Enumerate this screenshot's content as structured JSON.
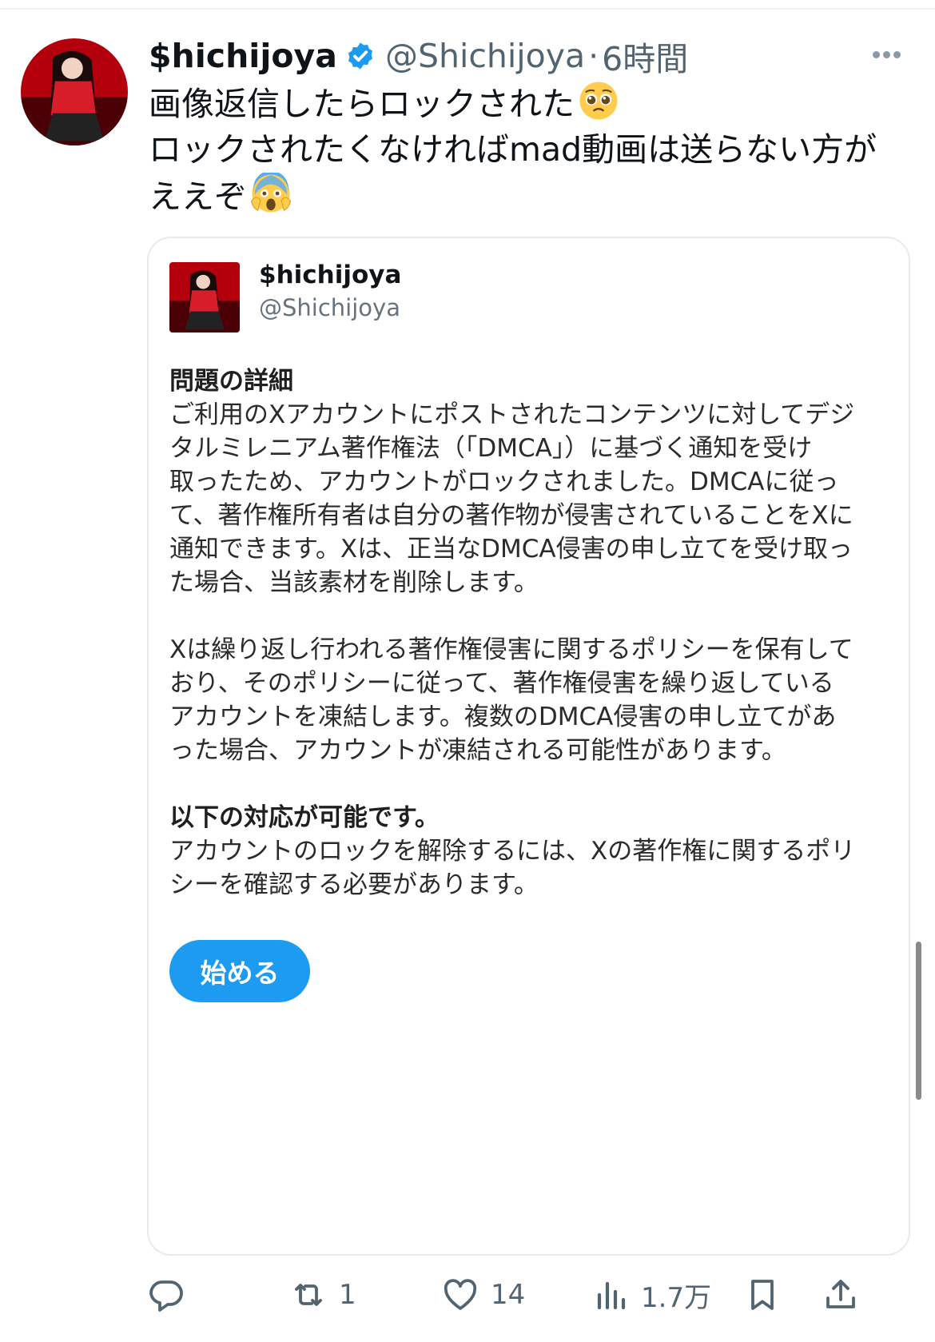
{
  "tweet": {
    "display_name": "$hichijoya",
    "handle": "@Shichijoya",
    "separator": "·",
    "time": "6時間",
    "text_lines": [
      "画像返信したらロックされた",
      "ロックされたくなければmad動画は送らない方が",
      "ええぞ"
    ],
    "emojis": [
      "pleading-face-emoji",
      "screaming-face-emoji"
    ]
  },
  "quote": {
    "display_name": "$hichijoya",
    "handle": "@Shichijoya",
    "section1_title": "問題の詳細",
    "section1_lines": [
      "ご利用のXアカウントにポストされたコンテンツに対してデジ",
      "タルミレニアム著作権法（「DMCA」）に基づく通知を受け",
      "取ったため、アカウントがロックされました。DMCAに従っ",
      "て、著作権所有者は自分の著作物が侵害されていることをXに",
      "通知できます。Xは、正当なDMCA侵害の申し立てを受け取っ",
      "た場合、当該素材を削除します。"
    ],
    "section2_lines": [
      "Xは繰り返し行われる著作権侵害に関するポリシーを保有して",
      "おり、そのポリシーに従って、著作権侵害を繰り返している",
      "アカウントを凍結します。複数のDMCA侵害の申し立てがあ",
      "った場合、アカウントが凍結される可能性があります。"
    ],
    "section3_title": "以下の対応が可能です。",
    "section3_lines": [
      "アカウントのロックを解除するには、Xの著作権に関するポリ",
      "シーを確認する必要があります。"
    ],
    "start_button": "始める"
  },
  "actions": {
    "reply_count": "",
    "retweet_count": "1",
    "like_count": "14",
    "views_count": "1.7万"
  },
  "colors": {
    "accent": "#1d9bf0",
    "secondary_text": "#536471",
    "text": "#0f1419"
  }
}
